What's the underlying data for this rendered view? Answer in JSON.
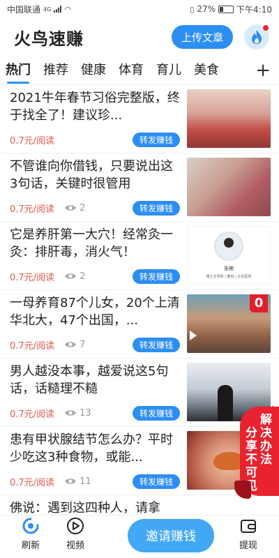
{
  "status": {
    "carrier": "中国联通",
    "network": "4G",
    "battery": "27%",
    "time": "下午4:10"
  },
  "header": {
    "app_title": "火鸟速赚",
    "upload_label": "上传文章",
    "flame_icon": "flame-icon"
  },
  "tabs": [
    {
      "label": "热门",
      "active": true
    },
    {
      "label": "推荐"
    },
    {
      "label": "健康"
    },
    {
      "label": "体育"
    },
    {
      "label": "育儿"
    },
    {
      "label": "美食"
    }
  ],
  "tab_add_label": "+",
  "articles": [
    {
      "title": "2021牛年春节习俗完整版，终于找全了！建议珍...",
      "price": "0.7元/阅读",
      "views": "",
      "share": "转发赚钱"
    },
    {
      "title": "不管谁向你借钱，只要说出这3句话，关键时很管用",
      "price": "0.7元/阅读",
      "views": "2",
      "share": "转发赚钱"
    },
    {
      "title": "它是养肝第一大穴！经常灸一灸：排肝毒，消火气！",
      "price": "0.7元/阅读",
      "views": "2",
      "share": "转发赚钱",
      "thumb_caption": "张艳",
      "thumb_subcaption": "博士生导师 | 教授 | 主任医师"
    },
    {
      "title": "一母养育87个儿女，20个上清华北大，47个出国，...",
      "price": "0.7元/阅读",
      "views": "7",
      "share": "转发赚钱",
      "thumb_badge": "0"
    },
    {
      "title": "男人越没本事，越爱说这5句话，话糙理不糙",
      "price": "0.7元/阅读",
      "views": "13",
      "share": "转发赚钱"
    },
    {
      "title": "患有甲状腺结节怎么办？平时少吃这3种食物，或能...",
      "price": "0.7元/阅读",
      "views": "11",
      "share": "转发赚钱"
    },
    {
      "title": "佛说：遇到这四种人，请拿",
      "price": "",
      "views": "",
      "share": ""
    }
  ],
  "float_badge": {
    "col1": "分享不可见",
    "col2": "解决办法",
    "close": "×"
  },
  "bottom_nav": {
    "refresh": "刷新",
    "video": "视频",
    "invite": "邀请赚钱",
    "withdraw": "提现"
  },
  "colors": {
    "accent": "#2d8ef2",
    "price": "#e2574c",
    "badge": "#e8222f"
  }
}
